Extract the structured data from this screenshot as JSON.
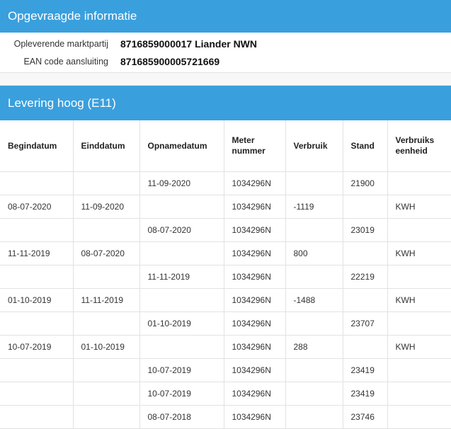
{
  "section1": {
    "title": "Opgevraagde informatie",
    "fields": [
      {
        "label": "Opleverende marktpartij",
        "value": "8716859000017 Liander NWN"
      },
      {
        "label": "EAN code aansluiting",
        "value": "871685900005721669"
      }
    ]
  },
  "section2": {
    "title": "Levering hoog (E11)",
    "columns": [
      "Begindatum",
      "Einddatum",
      "Opnamedatum",
      "Meter nummer",
      "Verbruik",
      "Stand",
      "Verbruiks eenheid"
    ],
    "rows": [
      [
        "",
        "",
        "11-09-2020",
        "1034296N",
        "",
        "21900",
        ""
      ],
      [
        "08-07-2020",
        "11-09-2020",
        "",
        "1034296N",
        "-1119",
        "",
        "KWH"
      ],
      [
        "",
        "",
        "08-07-2020",
        "1034296N",
        "",
        "23019",
        ""
      ],
      [
        "11-11-2019",
        "08-07-2020",
        "",
        "1034296N",
        "800",
        "",
        "KWH"
      ],
      [
        "",
        "",
        "11-11-2019",
        "1034296N",
        "",
        "22219",
        ""
      ],
      [
        "01-10-2019",
        "11-11-2019",
        "",
        "1034296N",
        "-1488",
        "",
        "KWH"
      ],
      [
        "",
        "",
        "01-10-2019",
        "1034296N",
        "",
        "23707",
        ""
      ],
      [
        "10-07-2019",
        "01-10-2019",
        "",
        "1034296N",
        "288",
        "",
        "KWH"
      ],
      [
        "",
        "",
        "10-07-2019",
        "1034296N",
        "",
        "23419",
        ""
      ],
      [
        "",
        "",
        "10-07-2019",
        "1034296N",
        "",
        "23419",
        ""
      ],
      [
        "",
        "",
        "08-07-2018",
        "1034296N",
        "",
        "23746",
        ""
      ]
    ]
  }
}
